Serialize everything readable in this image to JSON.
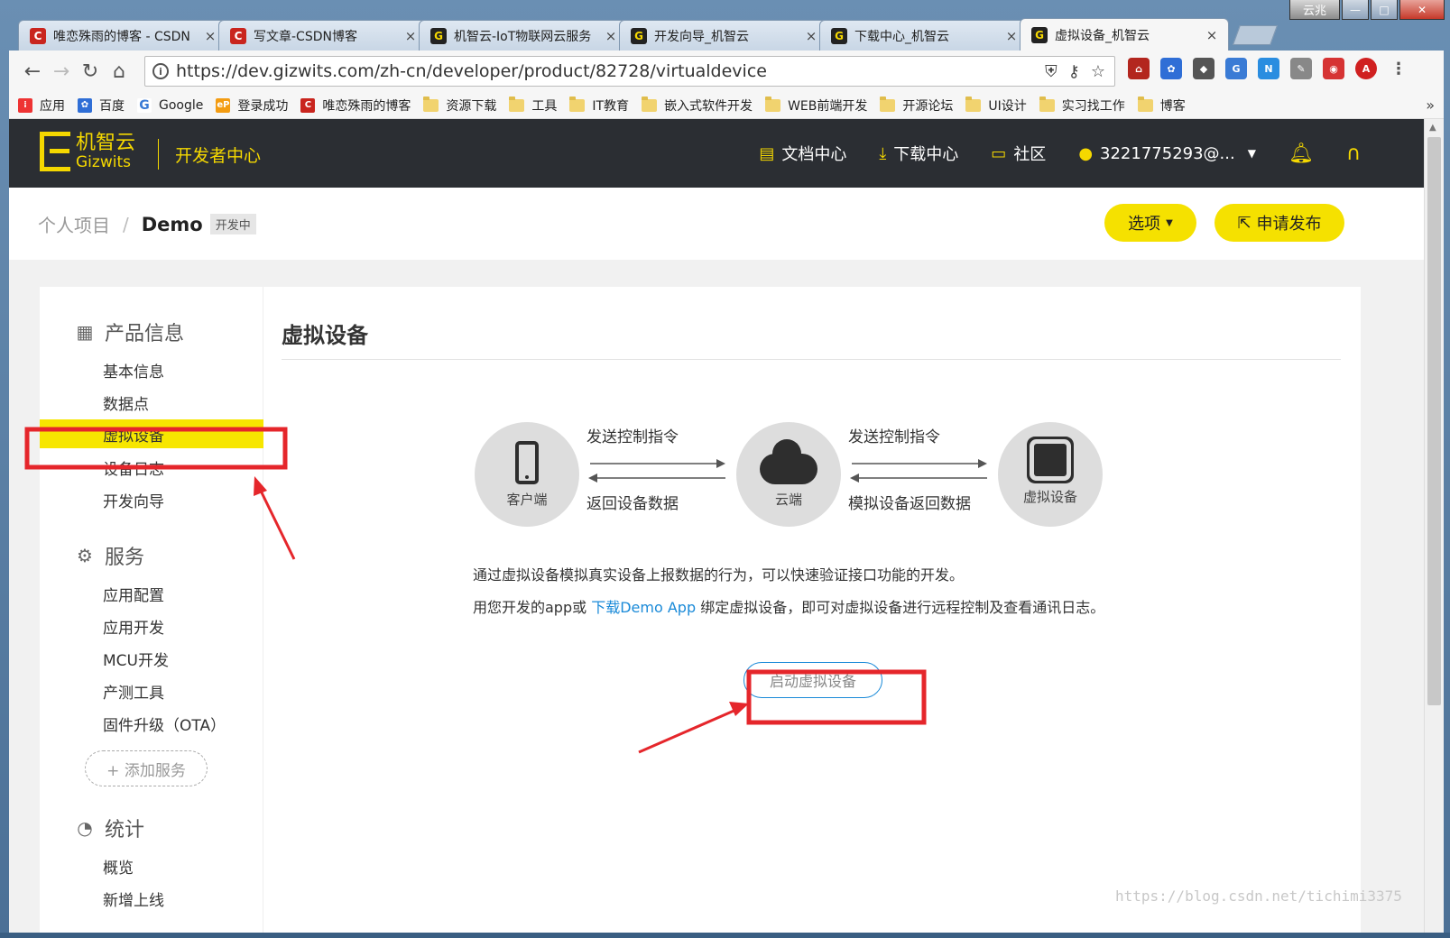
{
  "window": {
    "user_button": "云兆",
    "min_symbol": "—",
    "max_symbol": "□",
    "close_symbol": "✕"
  },
  "tabs": [
    {
      "title": "唯恋殊雨的博客 - CSDN",
      "icon": "C",
      "active": false
    },
    {
      "title": "写文章-CSDN博客",
      "icon": "C",
      "active": false
    },
    {
      "title": "机智云-IoT物联网云服务",
      "icon": "G",
      "active": false
    },
    {
      "title": "开发向导_机智云",
      "icon": "G",
      "active": false
    },
    {
      "title": "下载中心_机智云",
      "icon": "G",
      "active": false
    },
    {
      "title": "虚拟设备_机智云",
      "icon": "G",
      "active": true
    }
  ],
  "address_bar": {
    "url": "https://dev.gizwits.com/zh-cn/developer/product/82728/virtualdevice"
  },
  "bookmarks": [
    {
      "label": "应用",
      "icon": "apps-grid-icon"
    },
    {
      "label": "百度",
      "icon": "baidu-paw-icon"
    },
    {
      "label": "Google",
      "icon": "google-g-icon"
    },
    {
      "label": "登录成功",
      "icon": "ep-icon"
    },
    {
      "label": "唯恋殊雨的博客",
      "icon": "csdn-c-icon"
    },
    {
      "label": "资源下载",
      "icon": "folder-icon"
    },
    {
      "label": "工具",
      "icon": "folder-icon"
    },
    {
      "label": "IT教育",
      "icon": "folder-icon"
    },
    {
      "label": "嵌入式软件开发",
      "icon": "folder-icon"
    },
    {
      "label": "WEB前端开发",
      "icon": "folder-icon"
    },
    {
      "label": "开源论坛",
      "icon": "folder-icon"
    },
    {
      "label": "UI设计",
      "icon": "folder-icon"
    },
    {
      "label": "实习找工作",
      "icon": "folder-icon"
    },
    {
      "label": "博客",
      "icon": "folder-icon"
    }
  ],
  "bookmarks_more": "»",
  "site_header": {
    "logo_cn": "机智云",
    "logo_en": "Gizwits",
    "dev_center": "开发者中心",
    "nav": [
      {
        "label": "文档中心",
        "icon": "document-icon"
      },
      {
        "label": "下载中心",
        "icon": "download-icon"
      },
      {
        "label": "社区",
        "icon": "chat-icon"
      }
    ],
    "account": "3221775293@...",
    "bell_icon": "bell-icon",
    "support_icon": "headset-icon"
  },
  "breadcrumb": {
    "parent": "个人项目",
    "separator": "/",
    "current": "Demo",
    "status": "开发中",
    "options_label": "选项",
    "publish_label": "申请发布"
  },
  "sidebar": {
    "groups": [
      {
        "title": "产品信息",
        "items": [
          "基本信息",
          "数据点",
          "虚拟设备",
          "设备日志",
          "开发向导"
        ]
      },
      {
        "title": "服务",
        "items": [
          "应用配置",
          "应用开发",
          "MCU开发",
          "产测工具",
          "固件升级（OTA）"
        ]
      },
      {
        "title": "统计",
        "items": [
          "概览",
          "新增上线"
        ]
      }
    ],
    "active_item": "虚拟设备",
    "add_service": "+ 添加服务"
  },
  "main": {
    "title": "虚拟设备",
    "diagram": {
      "nodes": [
        "客户端",
        "云端",
        "虚拟设备"
      ],
      "send_label_1": "发送控制指令",
      "return_label_1": "返回设备数据",
      "send_label_2": "发送控制指令",
      "return_label_2": "模拟设备返回数据"
    },
    "desc_line1": "通过虚拟设备模拟真实设备上报数据的行为，可以快速验证接口功能的开发。",
    "desc_line2_pre": "用您开发的app或 ",
    "desc_line2_link": "下载Demo App",
    "desc_line2_post": " 绑定虚拟设备，即可对虚拟设备进行远程控制及查看通讯日志。",
    "start_button": "启动虚拟设备"
  },
  "watermark": "https://blog.csdn.net/tichimi3375",
  "colors": {
    "brand_yellow": "#f5e100",
    "header_dark": "#2b2e33",
    "link_blue": "#1a8ad8",
    "annotation_red": "#e5262b"
  }
}
